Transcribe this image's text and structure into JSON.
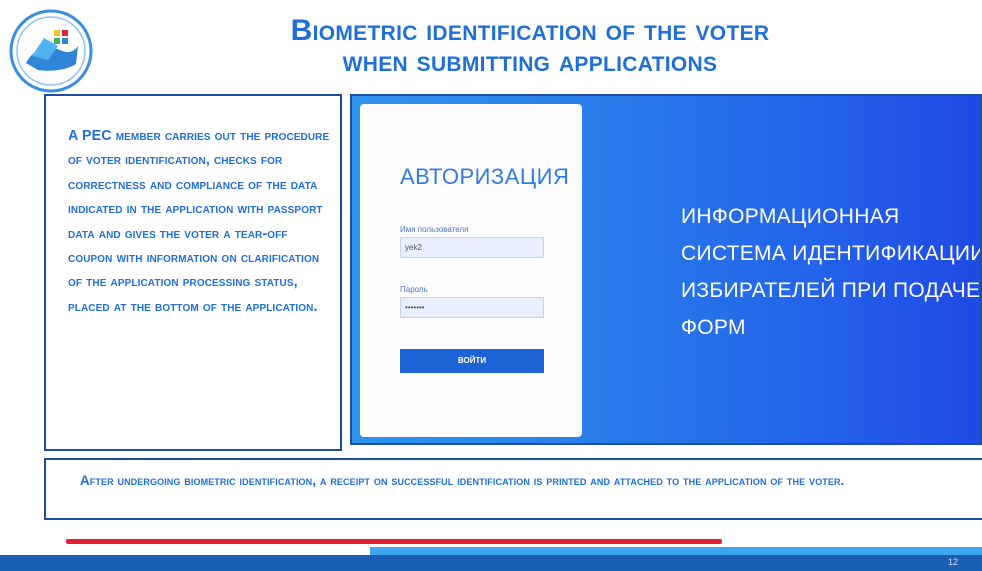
{
  "title": {
    "line1": "Biometric identification of the voter",
    "line2": "when submitting applications"
  },
  "left_panel": {
    "text": "A PEC member carries out the procedure of voter identification, checks for correctness and compliance of the data indicated in the application with passport data and gives the voter a tear-off coupon with information on clarification of the application processing status, placed at the bottom of the application."
  },
  "login_screen": {
    "heading": "АВТОРИЗАЦИЯ",
    "username_label": "Имя пользователя",
    "username_value": "yek2",
    "password_label": "Пароль",
    "password_value": "•••••••",
    "login_button": "ВОЙТИ",
    "system_name_lines": [
      "ИНФОРМАЦИОННАЯ",
      "СИСТЕМА ИДЕНТИФИКАЦИИ",
      "ИЗБИРАТЕЛЕЙ ПРИ ПОДАЧЕ",
      "ФОРМ"
    ]
  },
  "bottom_panel": {
    "text": "After undergoing biometric identification, a receipt on successful identification is printed and attached to the application of the voter."
  },
  "page_number": "12",
  "colors": {
    "accent": "#1f6fd8",
    "border": "#1c4f9c",
    "red_line": "#e5213a",
    "footer": "#1a5fb4"
  },
  "icons": {
    "logo": "election-commission-logo"
  }
}
